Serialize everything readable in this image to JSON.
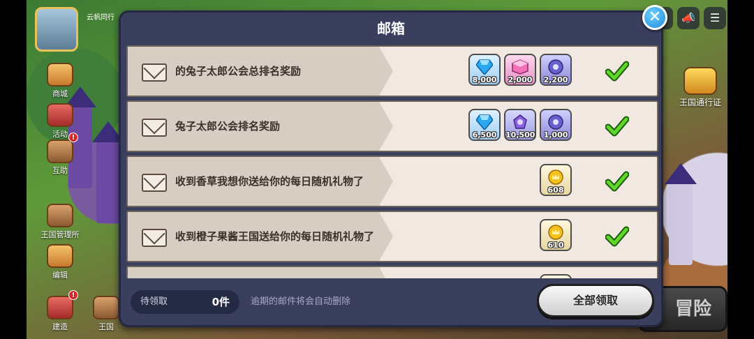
{
  "hud": {
    "profile_name": "云帆同行",
    "side_buttons": [
      {
        "label": "商城"
      },
      {
        "label": "活动"
      },
      {
        "label": "互助"
      },
      {
        "label": "王国管理所"
      },
      {
        "label": "编辑"
      },
      {
        "label": "建造"
      },
      {
        "label": "王国"
      }
    ],
    "kingdom_pass_label": "王国通行证",
    "adventure_label": "冒险"
  },
  "mailbox": {
    "title": "邮箱",
    "close_symbol": "✕",
    "mails": [
      {
        "subject": "的兔子太郎公会总排名奖励",
        "rewards": [
          {
            "icon": "crystal-icon",
            "quantity": "8,000"
          },
          {
            "icon": "cube-icon",
            "quantity": "2,000"
          },
          {
            "icon": "gear-token-icon",
            "quantity": "2,200"
          }
        ]
      },
      {
        "subject": "兔子太郎公会排名奖励",
        "rewards": [
          {
            "icon": "crystal-icon",
            "quantity": "6,500"
          },
          {
            "icon": "magic-orb-icon",
            "quantity": "10,500"
          },
          {
            "icon": "gear-token-icon",
            "quantity": "1,000"
          }
        ]
      },
      {
        "subject": "收到香草我想你送给你的每日随机礼物了",
        "rewards": [
          {
            "icon": "coin-icon",
            "quantity": "608"
          }
        ]
      },
      {
        "subject": "收到橙子果酱王国送给你的每日随机礼物了",
        "rewards": [
          {
            "icon": "coin-icon",
            "quantity": "610"
          }
        ]
      }
    ],
    "pending_label": "待领取",
    "pending_count": "0件",
    "auto_delete_note": "逾期的邮件将会自动删除",
    "claim_all_label": "全部领取"
  },
  "colors": {
    "modal_bg": "#3a3f5e",
    "row_bg": "#f1e9e1",
    "check_green": "#49c21e",
    "close_blue": "#1e88d8"
  }
}
